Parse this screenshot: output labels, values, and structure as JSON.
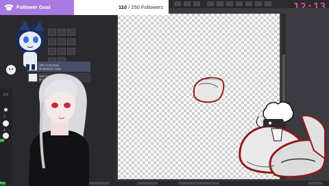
{
  "clock": "12:13",
  "follower_goal": {
    "title": "Follower Goal",
    "current": "110",
    "separator": " / ",
    "target_text": "250 Followers",
    "progress": 0.44,
    "fill_color": "#a97be0"
  },
  "layers": [
    {
      "line1": "100 % Normal",
      "line2": "Illustration Copy"
    },
    {
      "line1": "100 % Normal",
      "line2": "Illustration"
    }
  ],
  "brush_sizes": [
    "2.5",
    "3",
    "4"
  ],
  "icons": {
    "goal": "paw-icon"
  },
  "colors": {
    "accent": "#d94aa3",
    "stroke_red": "#9b1d1d"
  }
}
